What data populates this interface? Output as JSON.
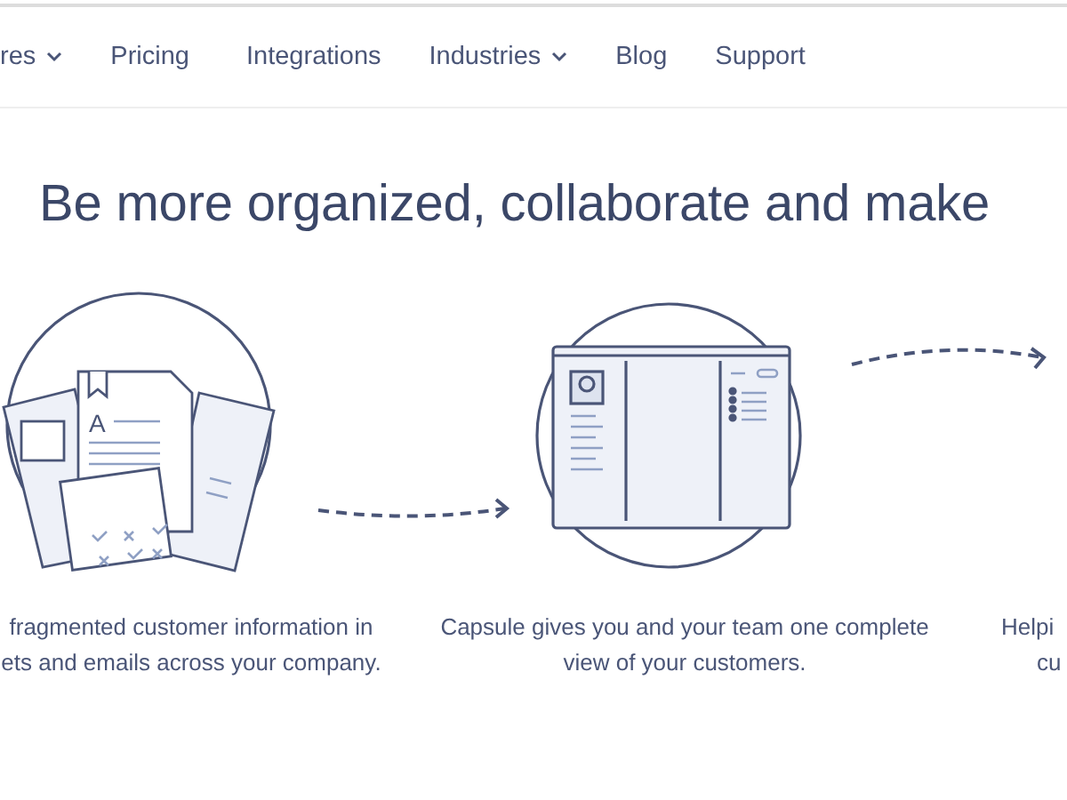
{
  "nav": {
    "items": [
      {
        "label": "res",
        "dropdown": true
      },
      {
        "label": "Pricing",
        "dropdown": false
      },
      {
        "label": "Integrations",
        "dropdown": false
      },
      {
        "label": "Industries",
        "dropdown": true
      },
      {
        "label": "Blog",
        "dropdown": false
      },
      {
        "label": "Support",
        "dropdown": false
      }
    ]
  },
  "heading": "Be more organized, collaborate and make",
  "steps": [
    {
      "kind": "documents",
      "letter": "A",
      "caption": [
        "fragmented customer information in",
        "ets and emails across your company."
      ]
    },
    {
      "kind": "crm-window",
      "caption": [
        "Capsule gives you and your team one complete",
        "view of your customers."
      ]
    },
    {
      "kind": "partial",
      "caption": [
        "Helpi",
        "cu"
      ]
    }
  ]
}
